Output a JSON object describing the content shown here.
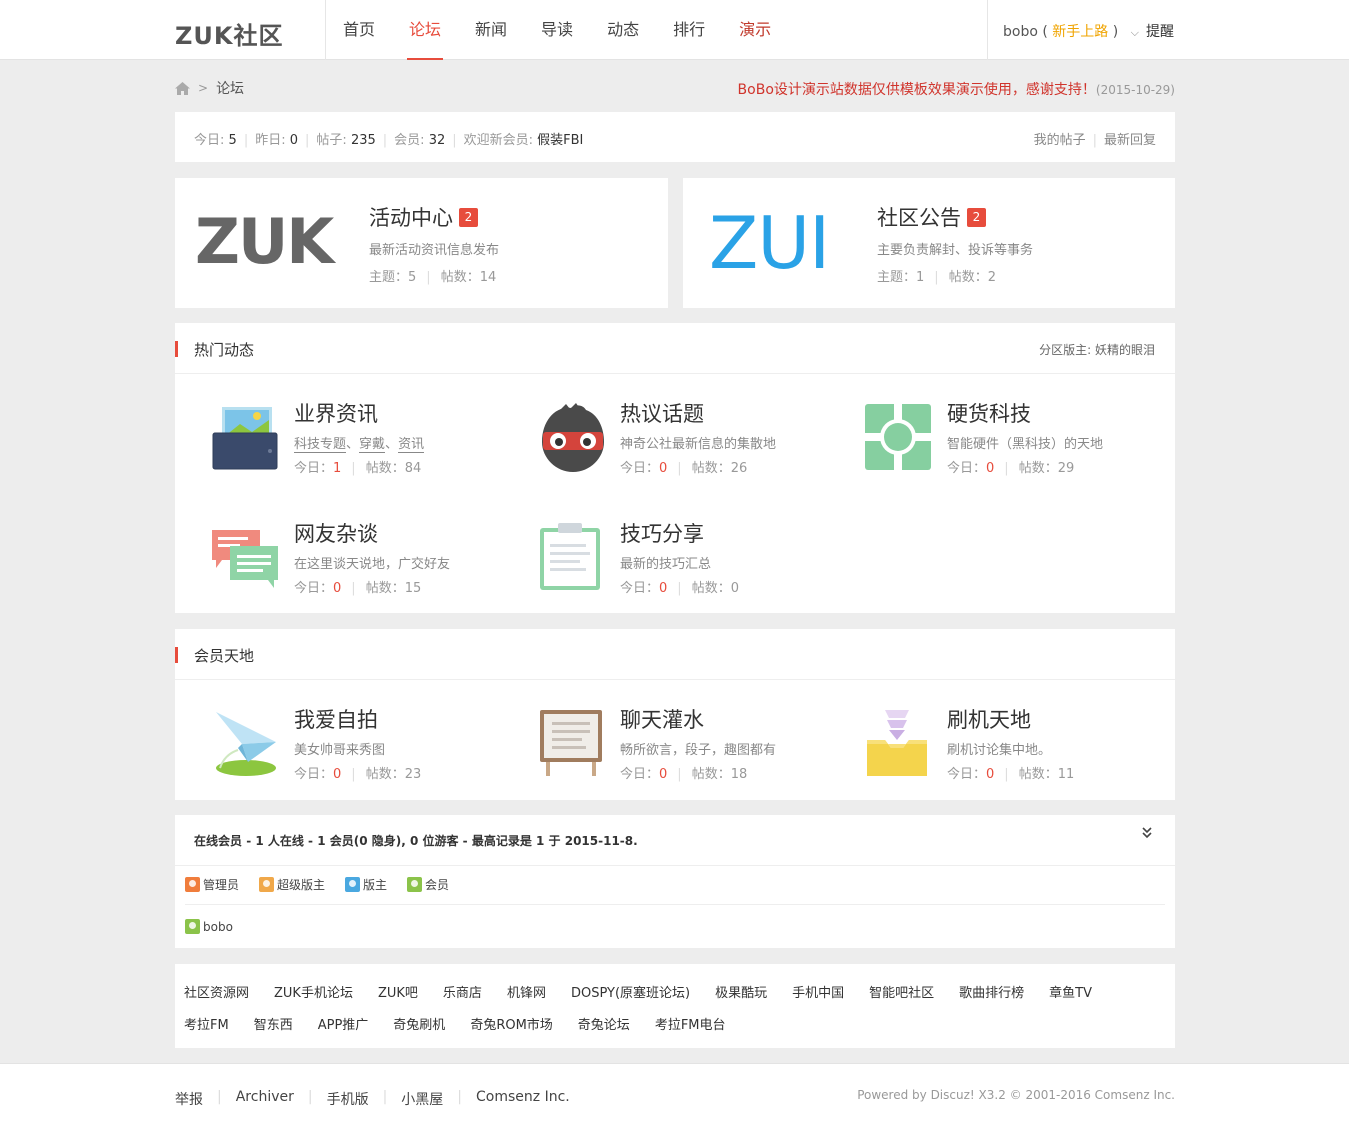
{
  "header": {
    "logo": "ZUK社区",
    "nav": [
      "首页",
      "论坛",
      "新闻",
      "导读",
      "动态",
      "排行",
      "演示"
    ],
    "active_nav": "论坛",
    "user": "bobo",
    "user_rank": "新手上路",
    "remind": "提醒"
  },
  "breadcrumb": {
    "current": "论坛"
  },
  "notice": {
    "text": "BoBo设计演示站数据仅供模板效果演示使用，感谢支持！",
    "date": "(2015-10-29)"
  },
  "stats": {
    "today_label": "今日:",
    "today": "5",
    "yesterday_label": "昨日:",
    "yesterday": "0",
    "posts_label": "帖子:",
    "posts": "235",
    "members_label": "会员:",
    "members": "32",
    "welcome_label": "欢迎新会员:",
    "newest_member": "假装FBI",
    "my_posts": "我的帖子",
    "latest_replies": "最新回复"
  },
  "featured": [
    {
      "logo": "ZUK",
      "title": "活动中心",
      "badge": "2",
      "desc": "最新活动资讯信息发布",
      "topics_label": "主题：",
      "topics": "5",
      "posts_label": "帖数：",
      "posts": "14"
    },
    {
      "logo": "ZUI",
      "title": "社区公告",
      "badge": "2",
      "desc": "主要负责解封、投诉等事务",
      "topics_label": "主题：",
      "topics": "1",
      "posts_label": "帖数：",
      "posts": "2"
    }
  ],
  "hot": {
    "title": "热门动态",
    "moderator_label": "分区版主:",
    "moderator": "妖精的眼泪",
    "forums": [
      {
        "name": "业界资讯",
        "desc_links": [
          "科技专题",
          "穿戴",
          "资讯"
        ],
        "desc_sep": "、",
        "today": "1",
        "posts": "84",
        "icon": "tablet-picture-icon"
      },
      {
        "name": "热议话题",
        "desc": "神奇公社最新信息的集散地",
        "today": "0",
        "posts": "26",
        "icon": "masked-face-icon"
      },
      {
        "name": "硬货科技",
        "desc": "智能硬件（黑科技）的天地",
        "today": "0",
        "posts": "29",
        "icon": "chip-icon"
      },
      {
        "name": "网友杂谈",
        "desc": "在这里谈天说地，广交好友",
        "today": "0",
        "posts": "15",
        "icon": "chat-bubbles-icon"
      },
      {
        "name": "技巧分享",
        "desc": "最新的技巧汇总",
        "today": "0",
        "posts": "0",
        "icon": "clipboard-icon"
      }
    ]
  },
  "member_world": {
    "title": "会员天地",
    "forums": [
      {
        "name": "我爱自拍",
        "desc": "美女帅哥来秀图",
        "today": "0",
        "posts": "23",
        "icon": "paper-plane-icon"
      },
      {
        "name": "聊天灌水",
        "desc": "畅所欲言，段子，趣图都有",
        "today": "0",
        "posts": "18",
        "icon": "easel-board-icon"
      },
      {
        "name": "刷机天地",
        "desc": "刷机讨论集中地。",
        "today": "0",
        "posts": "11",
        "icon": "inbox-download-icon"
      }
    ]
  },
  "labels": {
    "today": "今日：",
    "posts": "帖数："
  },
  "online": {
    "title": "在线会员",
    "summary": " - 1 人在线 - 1 会员(0 隐身), 0 位游客 - 最高记录是 1 于 2015-11-8.",
    "legend": [
      {
        "label": "管理员",
        "color": "#f07d3c"
      },
      {
        "label": "超级版主",
        "color": "#f0a84a"
      },
      {
        "label": "版主",
        "color": "#4aa8e0"
      },
      {
        "label": "会员",
        "color": "#8bc34a"
      }
    ],
    "users": [
      {
        "name": "bobo",
        "color": "#8bc34a"
      }
    ]
  },
  "links": {
    "row1": [
      "社区资源网",
      "ZUK手机论坛",
      "ZUK吧",
      "乐商店",
      "机锋网",
      "DOSPY(原塞班论坛)",
      "极果酷玩",
      "手机中国",
      "智能吧社区",
      "歌曲排行榜",
      "章鱼TV"
    ],
    "row2": [
      "考拉FM",
      "智东西",
      "APP推广",
      "奇兔刷机",
      "奇兔ROM市场",
      "奇兔论坛",
      "考拉FM电台"
    ]
  },
  "footer": {
    "links": [
      "举报",
      "Archiver",
      "手机版",
      "小黑屋",
      "Comsenz Inc."
    ],
    "powered": "Powered by Discuz! X3.2 © 2001-2016 Comsenz Inc."
  }
}
